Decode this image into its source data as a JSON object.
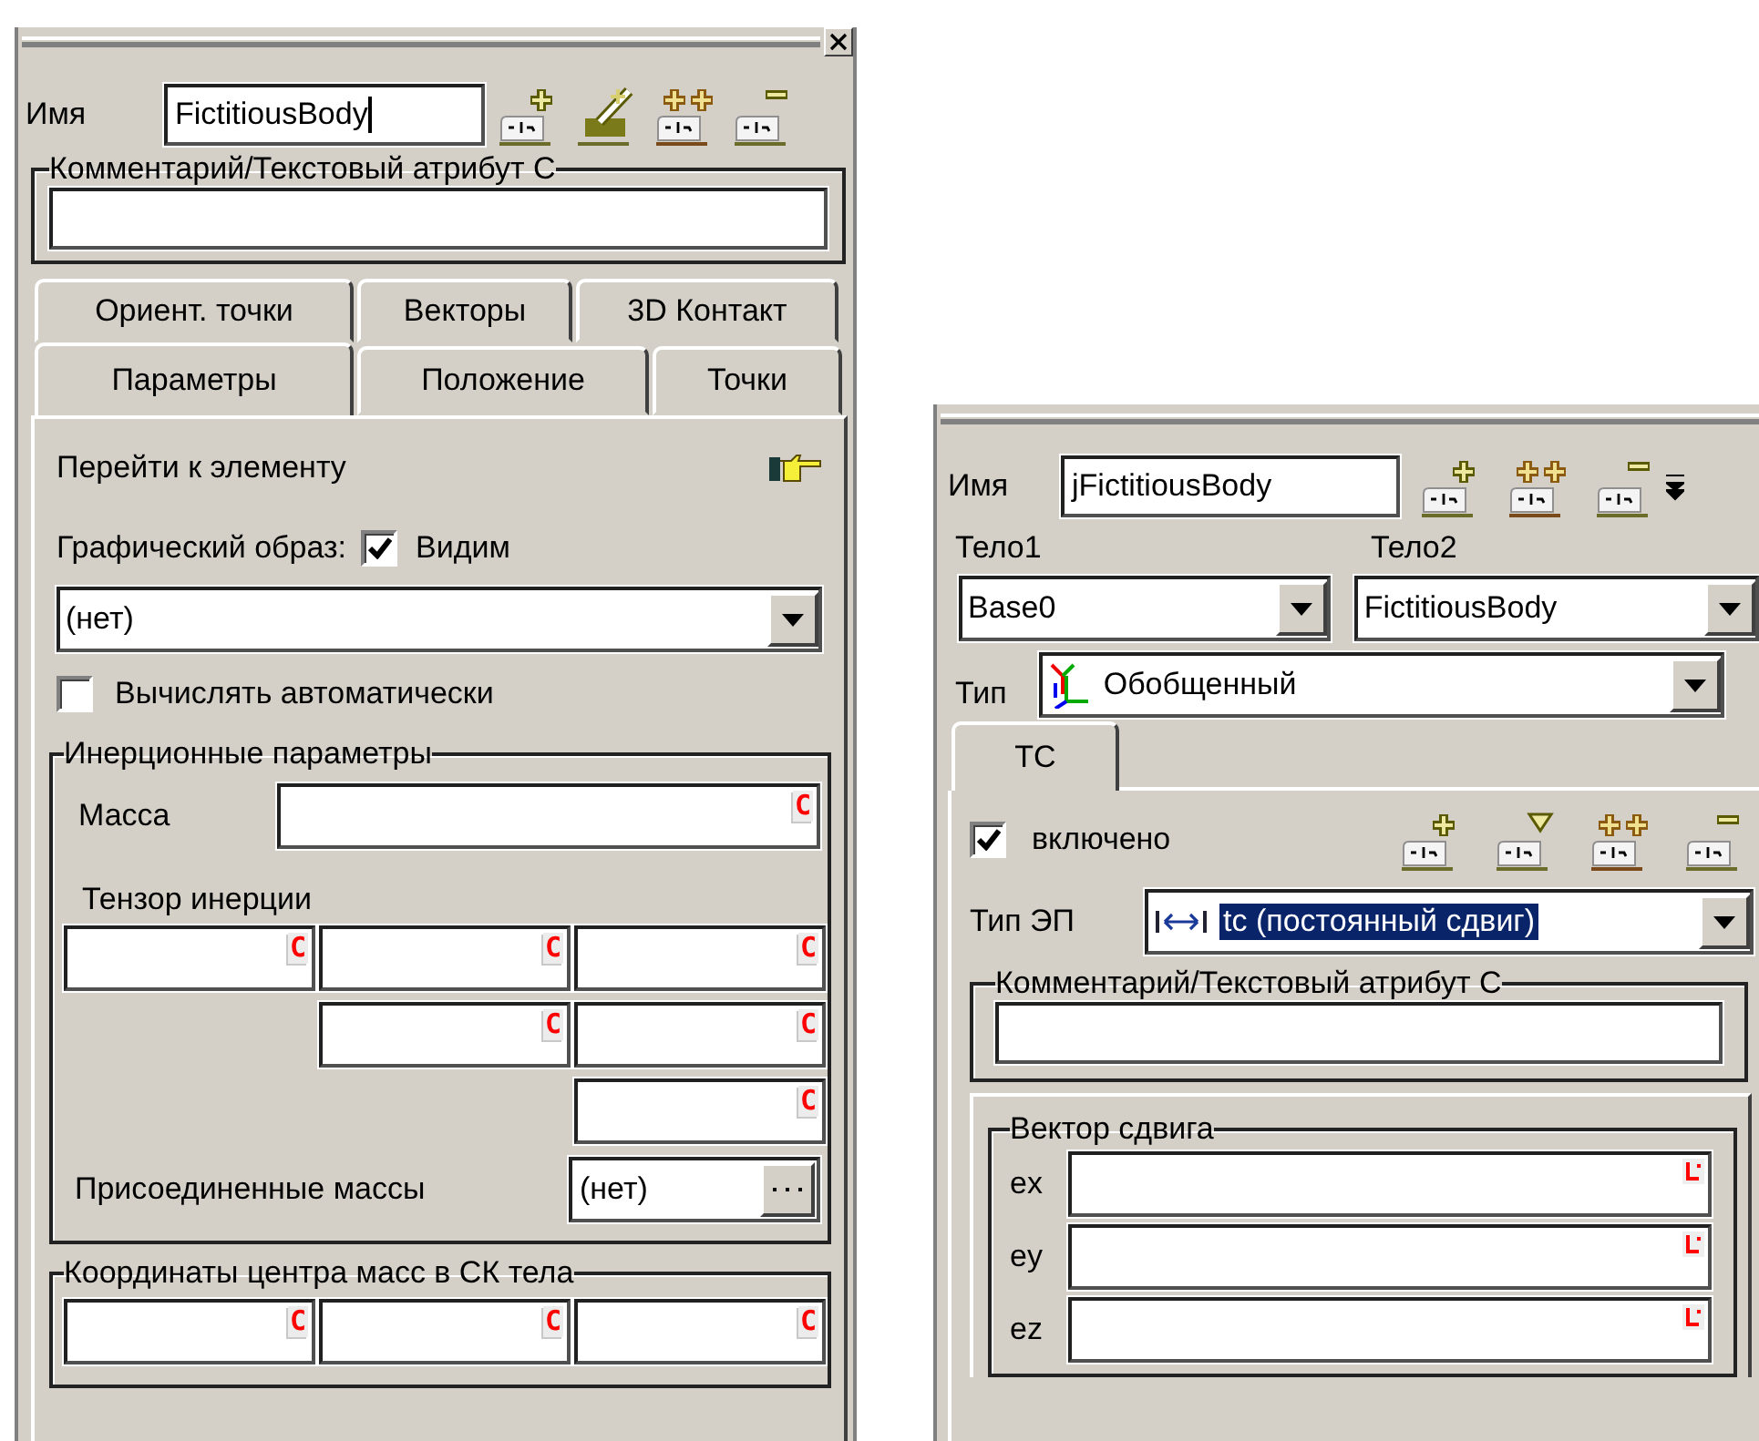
{
  "left_panel": {
    "name": {
      "label": "Имя",
      "value": "FictitiousBody"
    },
    "comment": {
      "title": "Комментарий/Текстовый атрибут C"
    },
    "tab_rows": [
      {
        "tabs": [
          {
            "label": "Ориент. точки",
            "selected": false
          },
          {
            "label": "Векторы",
            "selected": false
          },
          {
            "label": "3D Контакт",
            "selected": false
          }
        ]
      },
      {
        "tabs": [
          {
            "label": "Параметры",
            "selected": true
          },
          {
            "label": "Положение",
            "selected": false
          },
          {
            "label": "Точки",
            "selected": false
          }
        ]
      }
    ],
    "goto_label": "Перейти к элементу",
    "graphic": {
      "label": "Графический образ:",
      "visible": {
        "label": "Видим",
        "checked": true
      },
      "value": "(нет)"
    },
    "auto_calc": {
      "label": "Вычислять автоматически",
      "checked": false
    },
    "inertia": {
      "title": "Инерционные параметры",
      "mass": {
        "label": "Масса",
        "marker": "C"
      },
      "tensor": {
        "label": "Тензор инерции",
        "fields": [
          {
            "marker": "C"
          },
          {
            "marker": "C"
          },
          {
            "marker": "C"
          },
          {
            "marker": "C"
          },
          {
            "marker": "C"
          },
          {
            "marker": "C"
          }
        ]
      },
      "attached": {
        "label": "Присоединенные массы",
        "value": "(нет)"
      }
    },
    "center_of_mass": {
      "title": "Координаты центра масс в СК тела",
      "fields": [
        {
          "marker": "C"
        },
        {
          "marker": "C"
        },
        {
          "marker": "C"
        }
      ]
    }
  },
  "right_panel": {
    "name": {
      "label": "Имя",
      "value": "jFictitiousBody"
    },
    "body1": {
      "label": "Тело1",
      "value": "Base0"
    },
    "body2": {
      "label": "Тело2",
      "value": "FictitiousBody"
    },
    "type": {
      "label": "Тип",
      "value": "Обобщенный"
    },
    "tabs": [
      {
        "label": "ТС",
        "selected": true
      }
    ],
    "enabled": {
      "label": "включено",
      "checked": true
    },
    "ep_type": {
      "label": "Тип ЭП",
      "value": "tc (постоянный сдвиг)",
      "highlighted": true
    },
    "comment": {
      "title": "Комментарий/Текстовый атрибут C"
    },
    "shift_vector": {
      "title": "Вектор сдвига",
      "rows": [
        {
          "label": "ex"
        },
        {
          "label": "ey"
        },
        {
          "label": "ez"
        }
      ]
    }
  }
}
